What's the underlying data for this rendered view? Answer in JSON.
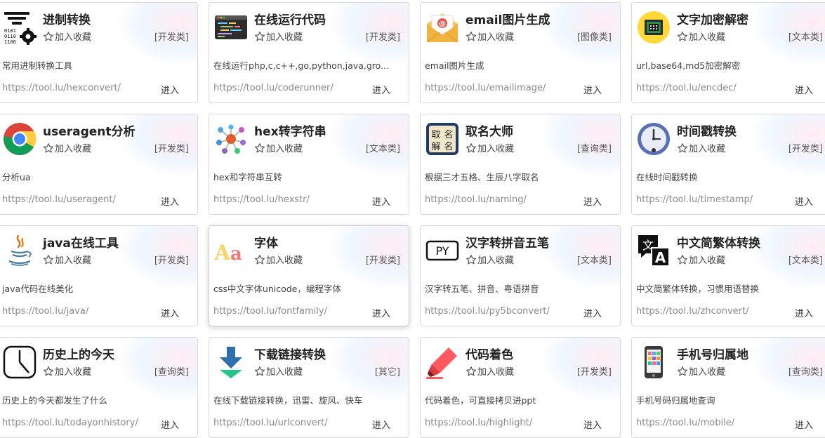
{
  "cards": [
    {
      "title": "进制转换",
      "fav": "加入收藏",
      "cat": "[开发类]",
      "desc": "常用进制转换工具",
      "url": "https://tool.lu/hexconvert/",
      "enter": "进入",
      "icon": "binary-gear-icon"
    },
    {
      "title": "在线运行代码",
      "fav": "加入收藏",
      "cat": "[开发类]",
      "desc": "在线运行php,c,c++,go,python,java,gro...",
      "url": "https://tool.lu/coderunner/",
      "enter": "进入",
      "icon": "code-editor-icon"
    },
    {
      "title": "email图片生成",
      "fav": "加入收藏",
      "cat": "[图像类]",
      "desc": "email图片生成",
      "url": "https://tool.lu/emailimage/",
      "enter": "进入",
      "icon": "email-envelope-icon"
    },
    {
      "title": "文字加密解密",
      "fav": "加入收藏",
      "cat": "[文本类]",
      "desc": "url,base64,md5加密解密",
      "url": "https://tool.lu/encdec/",
      "enter": "进入",
      "icon": "safe-lock-icon"
    },
    {
      "title": "useragent分析",
      "fav": "加入收藏",
      "cat": "[开发类]",
      "desc": "分析ua",
      "url": "https://tool.lu/useragent/",
      "enter": "进入",
      "icon": "chrome-icon"
    },
    {
      "title": "hex转字符串",
      "fav": "加入收藏",
      "cat": "[文本类]",
      "desc": "hex和字符串互转",
      "url": "https://tool.lu/hexstr/",
      "enter": "进入",
      "icon": "molecule-icon"
    },
    {
      "title": "取名大师",
      "fav": "加入收藏",
      "cat": "[查询类]",
      "desc": "根据三才五格、生辰八字取名",
      "url": "https://tool.lu/naming/",
      "enter": "进入",
      "icon": "naming-seal-icon"
    },
    {
      "title": "时间戳转换",
      "fav": "加入收藏",
      "cat": "[开发类]",
      "desc": "在线时间戳转换",
      "url": "https://tool.lu/timestamp/",
      "enter": "进入",
      "icon": "clock-icon"
    },
    {
      "title": "java在线工具",
      "fav": "加入收藏",
      "cat": "[开发类]",
      "desc": "java代码在线美化",
      "url": "https://tool.lu/java/",
      "enter": "进入",
      "icon": "java-cup-icon"
    },
    {
      "title": "字体",
      "fav": "加入收藏",
      "cat": "[开发类]",
      "desc": "css中文字体unicode，编程字体",
      "url": "https://tool.lu/fontfamily/",
      "enter": "进入",
      "icon": "font-aa-icon"
    },
    {
      "title": "汉字转拼音五笔",
      "fav": "加入收藏",
      "cat": "[文本类]",
      "desc": "汉字转五笔、拼音、粤语拼音",
      "url": "https://tool.lu/py5bconvert/",
      "enter": "进入",
      "icon": "py-badge-icon"
    },
    {
      "title": "中文简繁体转换",
      "fav": "加入收藏",
      "cat": "[文本类]",
      "desc": "中文简繁体转换，习惯用语替换",
      "url": "https://tool.lu/zhconvert/",
      "enter": "进入",
      "icon": "translate-icon"
    },
    {
      "title": "历史上的今天",
      "fav": "加入收藏",
      "cat": "[查询类]",
      "desc": "历史上的今天都发生了什么",
      "url": "https://tool.lu/todayonhistory/",
      "enter": "进入",
      "icon": "history-clock-icon"
    },
    {
      "title": "下载链接转换",
      "fav": "加入收藏",
      "cat": "[其它]",
      "desc": "在线下载链接转换，迅雷、旋风、快车",
      "url": "https://tool.lu/urlconvert/",
      "enter": "进入",
      "icon": "download-arrow-icon"
    },
    {
      "title": "代码着色",
      "fav": "加入收藏",
      "cat": "[开发类]",
      "desc": "代码着色，可直接拷贝进ppt",
      "url": "https://tool.lu/highlight/",
      "enter": "进入",
      "icon": "highlighter-icon"
    },
    {
      "title": "手机号归属地",
      "fav": "加入收藏",
      "cat": "[查询类]",
      "desc": "手机号码归属地查询",
      "url": "https://tool.lu/mobile/",
      "enter": "进入",
      "icon": "mobile-phone-icon"
    }
  ],
  "icon_text": {
    "font_letters": "Aa",
    "py_letters": "PY",
    "translate_zh": "文",
    "translate_en": "A",
    "naming_chars": [
      "取",
      "名",
      "解",
      "名"
    ]
  }
}
